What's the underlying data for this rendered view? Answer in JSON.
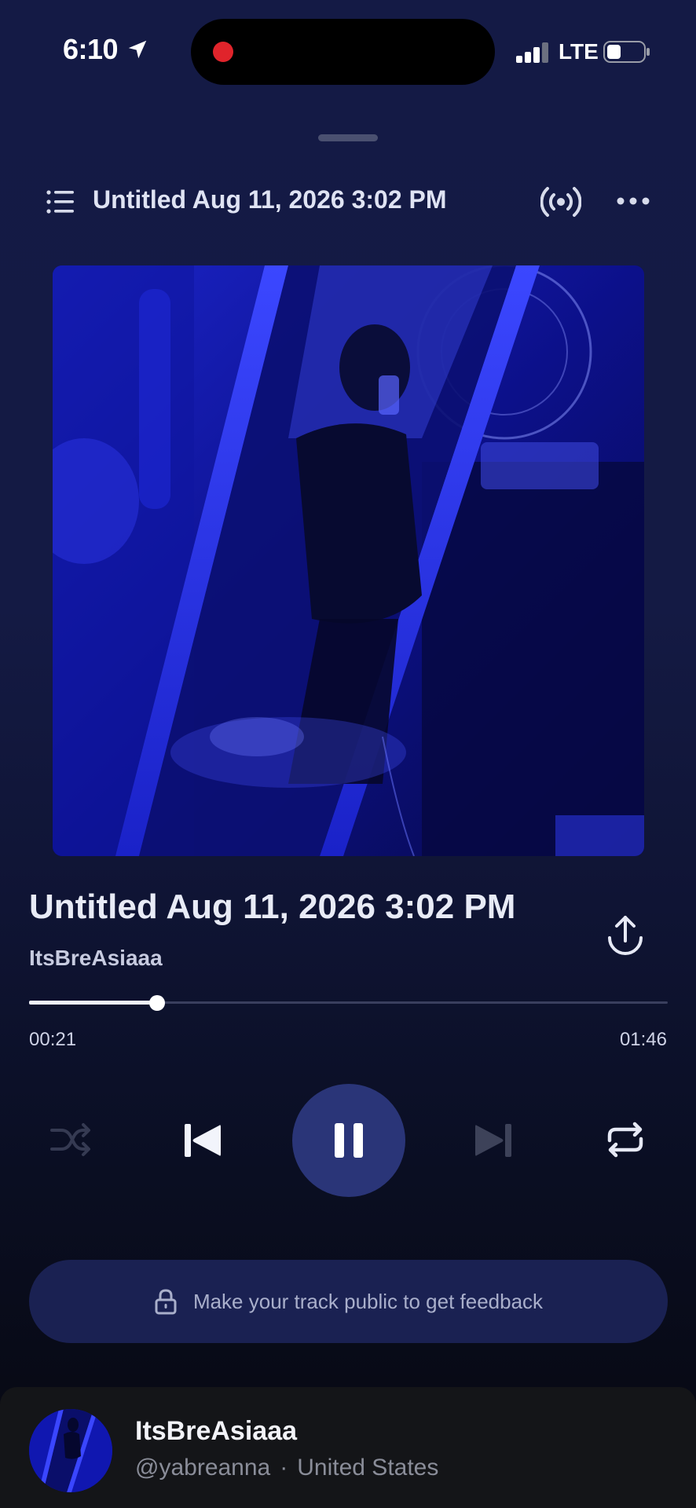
{
  "status_bar": {
    "time": "6:10",
    "network": "LTE",
    "icons": [
      "location-arrow-icon",
      "recording-dot",
      "signal-bars-icon",
      "battery-icon"
    ]
  },
  "header": {
    "title": "Untitled Aug 11, 2026 3:02 PM",
    "icons": [
      "list-icon",
      "broadcast-icon",
      "more-icon"
    ]
  },
  "track": {
    "title": "Untitled Aug 11, 2026 3:02 PM",
    "artist": "ItsBreAsiaaa",
    "elapsed": "00:21",
    "duration": "01:46",
    "progress_fraction": 0.2
  },
  "controls": {
    "shuffle_enabled": false,
    "state": "playing",
    "icons": [
      "shuffle-icon",
      "previous-icon",
      "pause-icon",
      "next-icon",
      "repeat-icon"
    ]
  },
  "feedback_banner": {
    "text": "Make your track public to get feedback",
    "icon": "lock-icon"
  },
  "profile": {
    "name": "ItsBreAsiaaa",
    "handle": "@yabreanna",
    "separator": "·",
    "location": "United States"
  },
  "colors": {
    "accent": "#2a3578",
    "background_top": "#141a45",
    "background_bottom": "#07080f",
    "artwork_tint": "#1a22d0",
    "record_dot": "#e0242b"
  }
}
